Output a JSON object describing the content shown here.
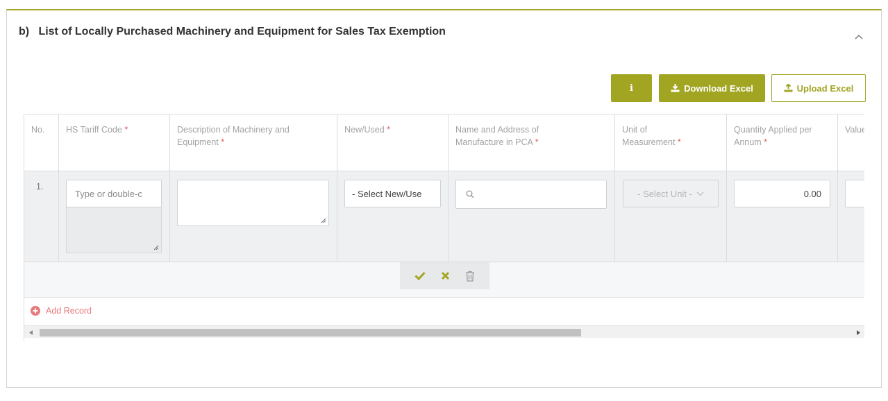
{
  "section": {
    "title": "b)   List of Locally Purchased Machinery and Equipment for Sales Tax Exemption"
  },
  "toolbar": {
    "info_label": "i",
    "download_label": "Download Excel",
    "upload_label": "Upload Excel"
  },
  "table": {
    "columns": [
      {
        "label": "No.",
        "required": false
      },
      {
        "label": "HS Tariff Code",
        "required": true
      },
      {
        "label": "Description of Machinery and Equipment",
        "required": true
      },
      {
        "label": "New/Used",
        "required": true
      },
      {
        "label": "Name and Address of Manufacture in PCA",
        "required": true
      },
      {
        "label": "Unit of Measurement",
        "required": true
      },
      {
        "label": "Quantity Applied per Annum",
        "required": true
      },
      {
        "label": "Value",
        "required": false
      }
    ],
    "required_marker": "*",
    "row": {
      "number": "1.",
      "hs_code_placeholder": "Type or double-c",
      "new_used_select": "- Select New/Use",
      "unit_select": "- Select Unit -",
      "quantity_value": "0.00"
    }
  },
  "actions": {
    "add_record": "Add Record"
  },
  "colors": {
    "accent": "#a1a522",
    "required": "#e0595b",
    "add_record": "#e8797b"
  }
}
